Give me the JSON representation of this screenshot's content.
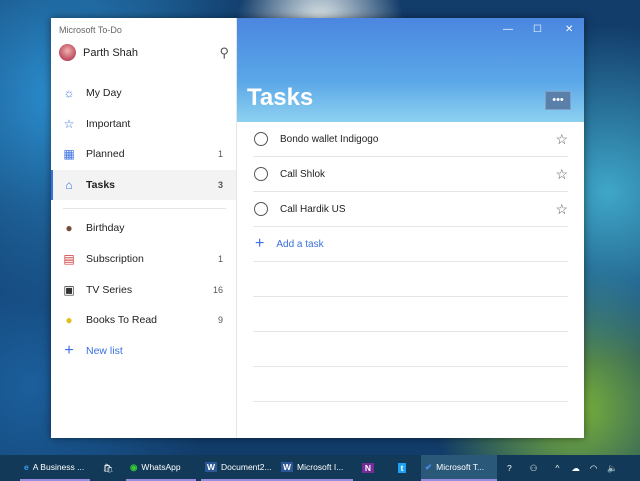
{
  "app": {
    "title": "Microsoft To-Do"
  },
  "user": {
    "name": "Parth Shah"
  },
  "sidebar": {
    "items": [
      {
        "label": "My Day",
        "icon": "sun-icon",
        "count": ""
      },
      {
        "label": "Important",
        "icon": "star-icon",
        "count": ""
      },
      {
        "label": "Planned",
        "icon": "calendar-icon",
        "count": "1"
      },
      {
        "label": "Tasks",
        "icon": "home-icon",
        "count": "3"
      }
    ],
    "lists": [
      {
        "label": "Birthday",
        "icon": "cake-icon",
        "count": ""
      },
      {
        "label": "Subscription",
        "icon": "calendar-page-icon",
        "count": "1"
      },
      {
        "label": "TV Series",
        "icon": "tv-icon",
        "count": "16"
      },
      {
        "label": "Books To Read",
        "icon": "lightbulb-icon",
        "count": "9"
      }
    ],
    "new_list": "New list"
  },
  "main": {
    "title": "Tasks",
    "more": "•••",
    "tasks": [
      "Bondo wallet Indigogo",
      "Call Shlok",
      "Call Hardik US"
    ],
    "add_task": "Add a task"
  },
  "taskbar": {
    "items": [
      "A Business ...",
      "WhatsApp",
      "Document2...",
      "Microsoft I...",
      "Microsoft T..."
    ]
  },
  "colors": {
    "accent": "#3a6fe0"
  }
}
